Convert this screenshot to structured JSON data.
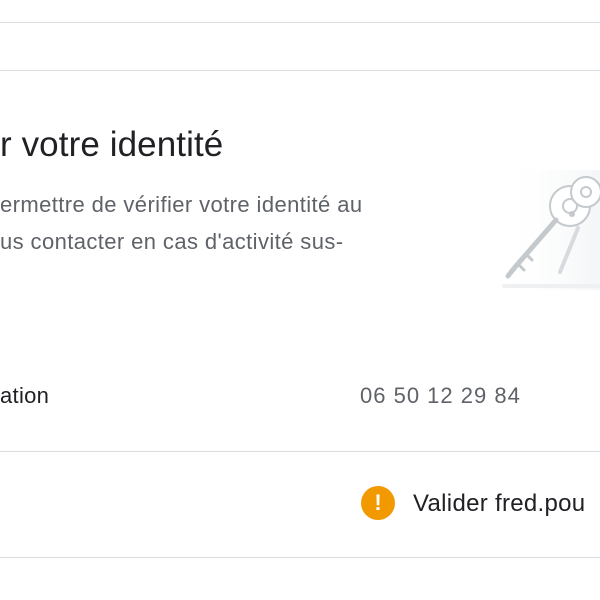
{
  "section": {
    "title": "r votre identité",
    "description": {
      "line1": "ermettre de vérifier votre identité au",
      "line2": "us contacter en cas d'activité sus-"
    }
  },
  "recovery_phone": {
    "label": "ation",
    "value": "06 50 12 29 84"
  },
  "recovery_email": {
    "warning_icon": "!",
    "text": "Valider fred.pou"
  },
  "colors": {
    "warning": "#f29900",
    "divider": "#dadce0",
    "primary_text": "#202124",
    "secondary_text": "#5f6368"
  },
  "illustration_icon": "keys-illustration"
}
